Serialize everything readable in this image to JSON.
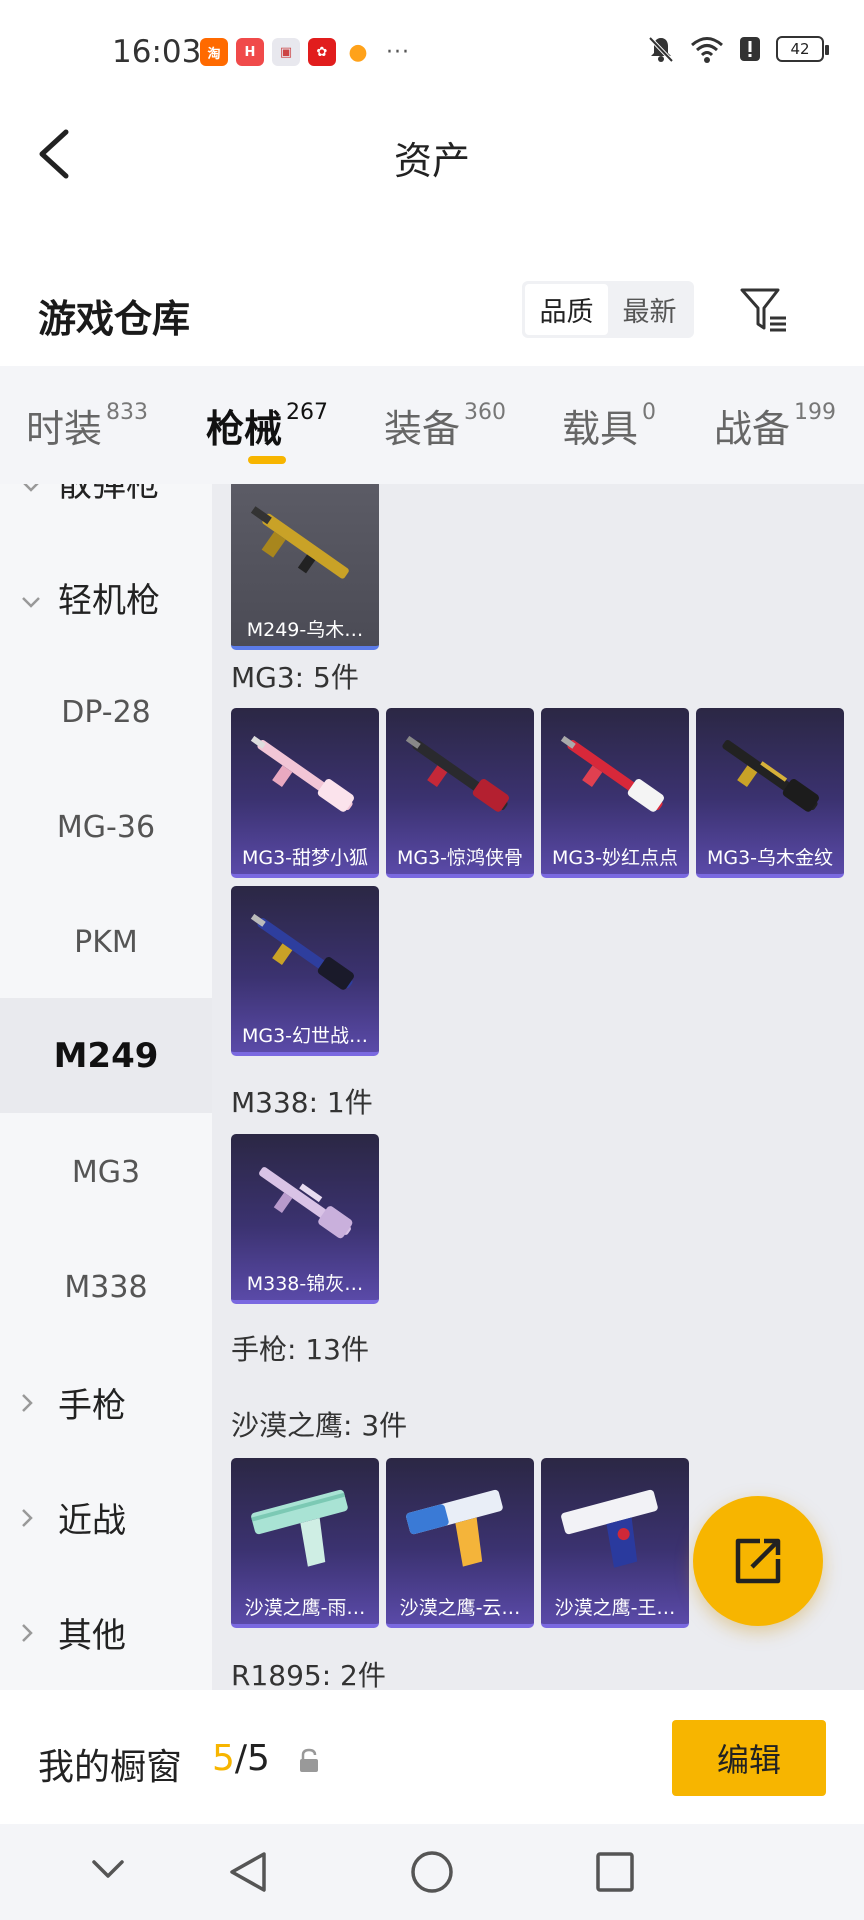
{
  "status_bar": {
    "time": "16:03",
    "apps": [
      {
        "icon": "taobao-app-icon",
        "glyph": "淘",
        "color": "#ff6a00"
      },
      {
        "icon": "huawei-app-icon",
        "glyph": "H",
        "color": "#f04a4a"
      },
      {
        "icon": "box-app-icon",
        "glyph": "▣",
        "color": "#e8e8ee"
      },
      {
        "icon": "redapp-app-icon",
        "glyph": "✿",
        "color": "#e11d1d"
      },
      {
        "icon": "chat-app-icon",
        "glyph": "●",
        "color": "#ffa21a"
      }
    ],
    "more": "···",
    "battery": "42"
  },
  "header": {
    "title": "资产"
  },
  "warehouse": {
    "title": "游戏仓库",
    "sort_options": [
      "品质",
      "最新"
    ]
  },
  "tabs": [
    {
      "label": "时装",
      "count": "833"
    },
    {
      "label": "枪械",
      "count": "267"
    },
    {
      "label": "装备",
      "count": "360"
    },
    {
      "label": "载具",
      "count": "0"
    },
    {
      "label": "战备",
      "count": "199"
    }
  ],
  "sidebar": {
    "items": [
      {
        "label": "散弹枪",
        "type": "group-partial"
      },
      {
        "label": "轻机枪",
        "type": "group-open"
      },
      {
        "label": "DP-28",
        "type": "sub"
      },
      {
        "label": "MG-36",
        "type": "sub"
      },
      {
        "label": "PKM",
        "type": "sub"
      },
      {
        "label": "M249",
        "type": "sub-active"
      },
      {
        "label": "MG3",
        "type": "sub"
      },
      {
        "label": "M338",
        "type": "sub"
      },
      {
        "label": "手枪",
        "type": "group"
      },
      {
        "label": "近战",
        "type": "group"
      },
      {
        "label": "其他",
        "type": "group"
      }
    ]
  },
  "content": {
    "m249_card": "M249-乌木…",
    "mg3_label": "MG3: 5件",
    "mg3_cards": [
      "MG3-甜梦小狐",
      "MG3-惊鸿侠骨",
      "MG3-妙红点点",
      "MG3-乌木金纹",
      "MG3-幻世战…"
    ],
    "m338_label": "M338: 1件",
    "m338_cards": [
      "M338-锦灰…"
    ],
    "pistol_label": "手枪: 13件",
    "deagle_label": "沙漠之鹰: 3件",
    "deagle_cards": [
      "沙漠之鹰-雨…",
      "沙漠之鹰-云…",
      "沙漠之鹰-王…"
    ],
    "r1895_label": "R1895: 2件"
  },
  "showcase": {
    "label": "我的橱窗",
    "current": "5",
    "total": "/5",
    "edit_label": "编辑"
  },
  "colors": {
    "accent": "#f7b500",
    "card_top": "#2b2744",
    "card_bottom": "#5a4aa8"
  }
}
